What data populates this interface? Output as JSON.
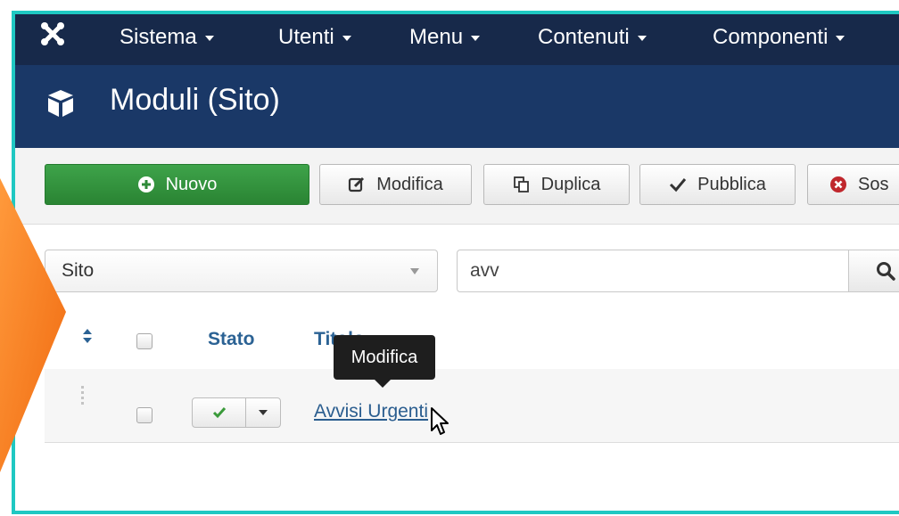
{
  "colors": {
    "frame_border": "#1fc8c2",
    "navbar_bg": "#17294a",
    "titlebar_bg": "#1a3867",
    "primary_button": "#2e8a38",
    "link": "#2a5d8f",
    "callout_arrow": "#f58220"
  },
  "navbar": {
    "logo_icon": "joomla-logo-icon",
    "items": [
      {
        "label": "Sistema"
      },
      {
        "label": "Utenti"
      },
      {
        "label": "Menu"
      },
      {
        "label": "Contenuti"
      },
      {
        "label": "Componenti"
      }
    ]
  },
  "header": {
    "icon": "cube-icon",
    "title": "Moduli (Sito)"
  },
  "toolbar": {
    "new_label": "Nuovo",
    "edit_label": "Modifica",
    "duplicate_label": "Duplica",
    "publish_label": "Pubblica",
    "trash_label": "Sos"
  },
  "filters": {
    "client_select": "Sito",
    "search_value": "avv"
  },
  "table": {
    "headers": {
      "status": "Stato",
      "title": "Titolo"
    },
    "rows": [
      {
        "title": "Avvisi Urgenti",
        "status": "published"
      }
    ]
  },
  "tooltip": {
    "text": "Modifica"
  }
}
